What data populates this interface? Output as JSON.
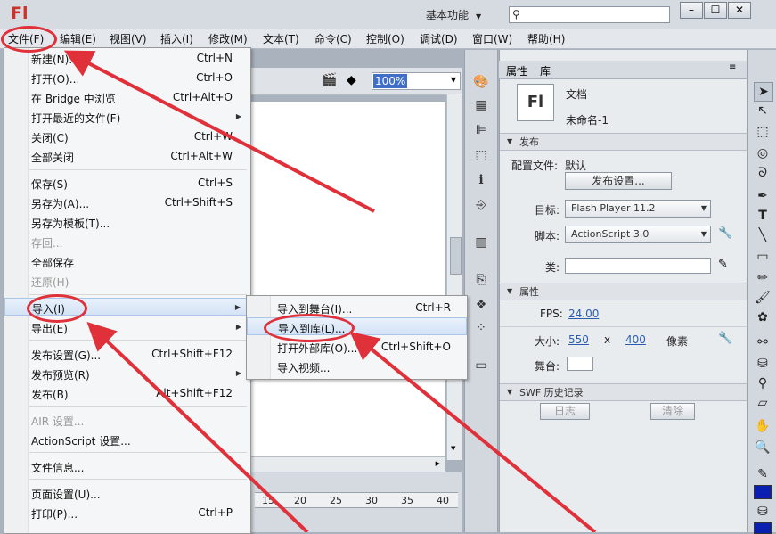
{
  "titlebar": {
    "logo": "Fl",
    "workspace": "基本功能",
    "search_placeholder": "",
    "min": "–",
    "max": "☐",
    "close": "✕"
  },
  "menubar": [
    "文件(F)",
    "编辑(E)",
    "视图(V)",
    "插入(I)",
    "修改(M)",
    "文本(T)",
    "命令(C)",
    "控制(O)",
    "调试(D)",
    "窗口(W)",
    "帮助(H)"
  ],
  "stagebar": {
    "zoom": "100%"
  },
  "timeline": {
    "ticks": [
      "15",
      "20",
      "25",
      "30",
      "35",
      "40"
    ]
  },
  "file_menu": [
    {
      "label": "新建(N)...",
      "shortcut": "Ctrl+N"
    },
    {
      "label": "打开(O)...",
      "shortcut": "Ctrl+O"
    },
    {
      "label": "在 Bridge 中浏览",
      "shortcut": "Ctrl+Alt+O"
    },
    {
      "label": "打开最近的文件(F)",
      "shortcut": ""
    },
    {
      "label": "关闭(C)",
      "shortcut": "Ctrl+W"
    },
    {
      "label": "全部关闭",
      "shortcut": "Ctrl+Alt+W"
    },
    {
      "label": "保存(S)",
      "shortcut": "Ctrl+S"
    },
    {
      "label": "另存为(A)...",
      "shortcut": "Ctrl+Shift+S"
    },
    {
      "label": "另存为模板(T)...",
      "shortcut": ""
    },
    {
      "label": "存回...",
      "shortcut": ""
    },
    {
      "label": "全部保存",
      "shortcut": ""
    },
    {
      "label": "还原(H)",
      "shortcut": ""
    },
    {
      "label": "导入(I)",
      "shortcut": ""
    },
    {
      "label": "导出(E)",
      "shortcut": ""
    },
    {
      "label": "发布设置(G)...",
      "shortcut": "Ctrl+Shift+F12"
    },
    {
      "label": "发布预览(R)",
      "shortcut": ""
    },
    {
      "label": "发布(B)",
      "shortcut": "Alt+Shift+F12"
    },
    {
      "label": "AIR 设置...",
      "shortcut": ""
    },
    {
      "label": "ActionScript 设置...",
      "shortcut": ""
    },
    {
      "label": "文件信息...",
      "shortcut": ""
    },
    {
      "label": "页面设置(U)...",
      "shortcut": ""
    },
    {
      "label": "打印(P)...",
      "shortcut": "Ctrl+P"
    }
  ],
  "import_submenu": [
    {
      "label": "导入到舞台(I)...",
      "shortcut": "Ctrl+R"
    },
    {
      "label": "导入到库(L)...",
      "shortcut": ""
    },
    {
      "label": "打开外部库(O)...",
      "shortcut": "Ctrl+Shift+O"
    },
    {
      "label": "导入视频...",
      "shortcut": ""
    }
  ],
  "properties": {
    "tab_props": "属性",
    "tab_library": "库",
    "doc_badge": "Fl",
    "doc_type": "文档",
    "doc_name": "未命名-1",
    "section_publish": "发布",
    "profile_label": "配置文件:",
    "profile_value": "默认",
    "publish_settings_button": "发布设置...",
    "target_label": "目标:",
    "target_value": "Flash Player 11.2",
    "script_label": "脚本:",
    "script_value": "ActionScript 3.0",
    "class_label": "类:",
    "section_props": "属性",
    "fps_label": "FPS:",
    "fps_value": "24.00",
    "size_label": "大小:",
    "width_value": "550",
    "x_label": "x",
    "height_value": "400",
    "unit_label": "像素",
    "stage_label": "舞台:",
    "section_swf": "SWF 历史记录",
    "log_button": "日志",
    "clear_button": "清除"
  },
  "colors": {
    "accent_red": "#e0303a",
    "zoom_highlight": "#3f6fc6",
    "link_blue": "#2a5db0"
  }
}
